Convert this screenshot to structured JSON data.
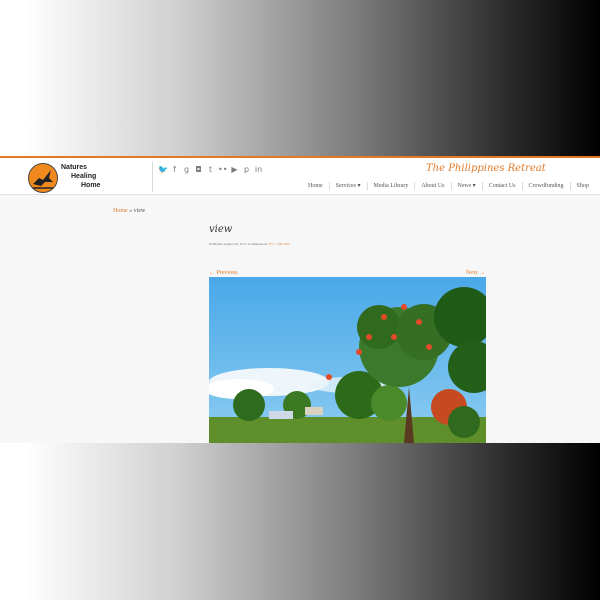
{
  "site": {
    "logo_lines": [
      "Natures",
      "Healing",
      "Home"
    ],
    "tagline": "The Philippines Retreat"
  },
  "social_icons": [
    "twitter-icon",
    "facebook-icon",
    "google-plus-icon",
    "instagram-icon",
    "tumblr-icon",
    "flickr-icon",
    "youtube-icon",
    "pinterest-icon",
    "linkedin-icon"
  ],
  "nav": {
    "items": [
      "Home",
      "Services ▾",
      "Media Library",
      "About Us",
      "News ▾",
      "Contact Us",
      "Crowdfunding",
      "Shop"
    ]
  },
  "breadcrumb": {
    "home": "Home",
    "separator": " » ",
    "current": "view"
  },
  "post": {
    "title": "view",
    "published_prefix": "Published August 20, 2017 in dimensions ",
    "published_link": "277 × 166 view",
    "prev_label": "← Previous",
    "next_label": "Next →"
  },
  "colors": {
    "accent": "#e07a2a"
  }
}
